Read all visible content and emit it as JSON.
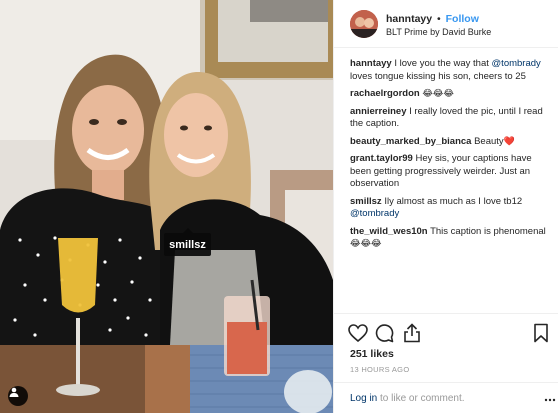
{
  "photo": {
    "tag_label": "smillsz"
  },
  "header": {
    "username": "hanntayy",
    "separator": "•",
    "follow_label": "Follow",
    "location": "BLT Prime by David Burke"
  },
  "caption": {
    "username": "hanntayy",
    "text_before": " I love you the way that ",
    "mention": "@tombrady",
    "text_after": " loves tongue kissing his son, cheers to 25"
  },
  "comments": [
    {
      "username": "rachaelrgordon",
      "text": " ",
      "emoji": "😂😂😂"
    },
    {
      "username": "annierreiney",
      "text": " I really loved the pic, until I read the caption.",
      "emoji": ""
    },
    {
      "username": "beauty_marked_by_bianca",
      "text": " Beauty",
      "emoji": "❤️"
    },
    {
      "username": "grant.taylor99",
      "text": " Hey sis, your captions have been getting progressively weirder. Just an observation",
      "emoji": ""
    },
    {
      "username": "smillsz",
      "text": " Ily almost as much as I love tb12 ",
      "mention": "@tombrady",
      "emoji": ""
    },
    {
      "username": "the_wild_wes10n",
      "text": " This caption is phenomenal ",
      "emoji": "😂😂😂"
    }
  ],
  "actions": {
    "like_icon": "heart-icon",
    "comment_icon": "comment-icon",
    "share_icon": "share-icon",
    "save_icon": "bookmark-icon",
    "likes_text": "251 likes",
    "time_text": "13 HOURS AGO"
  },
  "login": {
    "link_text": "Log in",
    "rest_text": " to like or comment."
  },
  "colors": {
    "link_blue": "#3897f0",
    "mention_blue": "#003569",
    "muted": "#999999",
    "text": "#262626",
    "border": "#efefef"
  }
}
